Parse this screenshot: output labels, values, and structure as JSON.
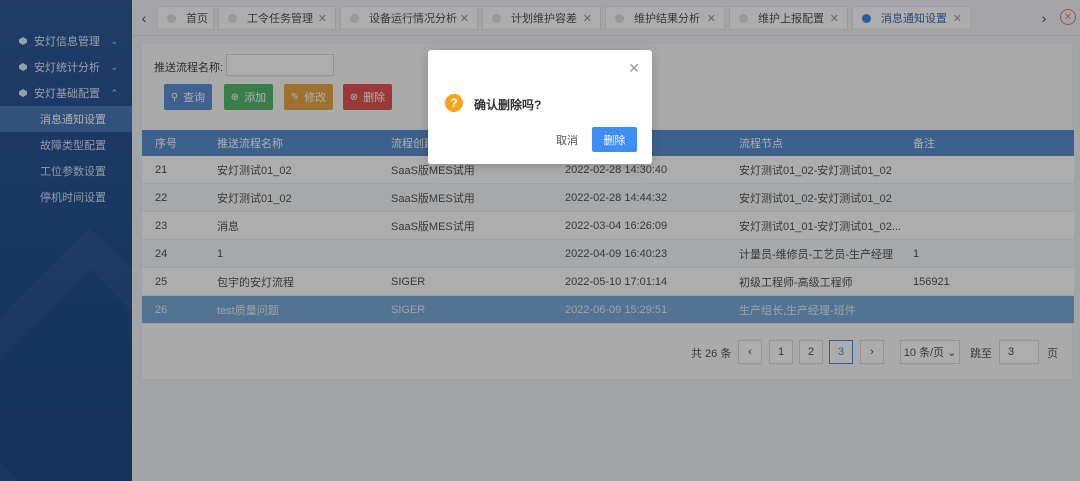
{
  "sidebar": {
    "groups": [
      {
        "label": "安灯信息管理",
        "chevron": "⌄"
      },
      {
        "label": "安灯统计分析",
        "chevron": "⌄"
      },
      {
        "label": "安灯基础配置",
        "chevron": "⌃"
      }
    ],
    "items": [
      {
        "label": "消息通知设置"
      },
      {
        "label": "故障类型配置"
      },
      {
        "label": "工位参数设置"
      },
      {
        "label": "停机时间设置"
      }
    ]
  },
  "tabs": [
    {
      "label": "首页"
    },
    {
      "label": "工令任务管理"
    },
    {
      "label": "设备运行情况分析"
    },
    {
      "label": "计划维护容差"
    },
    {
      "label": "维护结果分析"
    },
    {
      "label": "维护上报配置"
    },
    {
      "label": "消息通知设置"
    }
  ],
  "search": {
    "label": "推送流程名称:",
    "value": ""
  },
  "toolbar": {
    "query": "查询",
    "add": "添加",
    "edit": "修改",
    "delete": "删除"
  },
  "table": {
    "headers": [
      "序号",
      "推送流程名称",
      "流程创建",
      "",
      "流程节点",
      "备注"
    ],
    "rows": [
      [
        "21",
        "安灯测试01_02",
        "SaaS版MES试用",
        "2022-02-28 14:30:40",
        "安灯测试01_02-安灯测试01_02",
        ""
      ],
      [
        "22",
        "安灯测试01_02",
        "SaaS版MES试用",
        "2022-02-28 14:44:32",
        "安灯测试01_02-安灯测试01_02",
        ""
      ],
      [
        "23",
        "消息",
        "SaaS版MES试用",
        "2022-03-04 16:26:09",
        "安灯测试01_01-安灯测试01_02...",
        ""
      ],
      [
        "24",
        "1",
        "",
        "2022-04-09 16:40:23",
        "计量员-维修员-工艺员-生产经理",
        "1"
      ],
      [
        "25",
        "包宇的安灯流程",
        "SIGER",
        "2022-05-10 17:01:14",
        "初级工程师-高级工程师",
        "156921"
      ],
      [
        "26",
        "test质量问题",
        "SIGER",
        "2022-06-09 15:29:51",
        "生产组长,生产经理-班件",
        ""
      ]
    ]
  },
  "pagination": {
    "total": "共 26 条",
    "pages": [
      "1",
      "2",
      "3"
    ],
    "current": "3",
    "page_size": "10 条/页",
    "goto_label": "跳至",
    "goto_value": "3",
    "page_suffix": "页"
  },
  "dialog": {
    "message": "确认删除吗?",
    "cancel": "取消",
    "confirm": "删除"
  },
  "colors": {
    "primary": "#3d8df2",
    "header": "#5b8fd0",
    "sidebar": "#2e5a9a",
    "warning": "#f7a31c"
  }
}
